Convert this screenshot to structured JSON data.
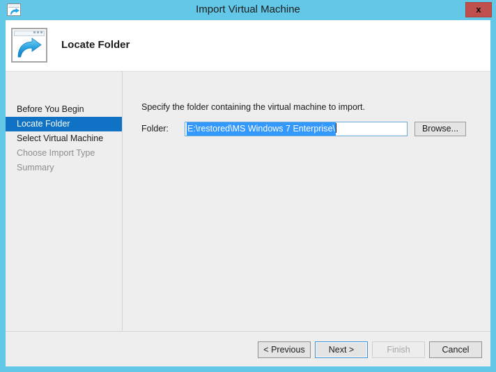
{
  "window": {
    "title": "Import Virtual Machine",
    "title_icon": "import-vm-window-icon",
    "close_label": "x",
    "frame_color": "#63c7e8"
  },
  "header": {
    "title": "Locate Folder",
    "icon": "window-with-right-arrow-icon"
  },
  "sidebar": {
    "items": [
      {
        "label": "Before You Begin",
        "state": "normal"
      },
      {
        "label": "Locate Folder",
        "state": "active"
      },
      {
        "label": "Select Virtual Machine",
        "state": "normal"
      },
      {
        "label": "Choose Import Type",
        "state": "dim"
      },
      {
        "label": "Summary",
        "state": "dim"
      }
    ],
    "active_color": "#0f72c4"
  },
  "content": {
    "instruction": "Specify the folder containing the virtual machine to import.",
    "folder_label": "Folder:",
    "folder_value": "E:\\restored\\MS Windows 7 Enterprise\\",
    "folder_selected": true,
    "browse_label": "Browse..."
  },
  "footer": {
    "previous_label": "< Previous",
    "next_label": "Next >",
    "finish_label": "Finish",
    "cancel_label": "Cancel"
  }
}
